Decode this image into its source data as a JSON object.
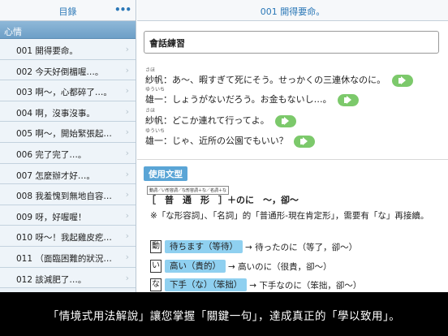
{
  "sidebar": {
    "title": "目錄",
    "section": "心情",
    "items": [
      {
        "label": "001 開得要命。"
      },
      {
        "label": "002 今天好倒楣喔…。"
      },
      {
        "label": "003 啊～，心都碎了…。"
      },
      {
        "label": "004 啊，沒事沒事。"
      },
      {
        "label": "005 啊～，開始緊張起…"
      },
      {
        "label": "006 完了完了…。"
      },
      {
        "label": "007 怎麼辦才好…。"
      },
      {
        "label": "008 我羞愧到無地自容…"
      },
      {
        "label": "009 呀，好喔喔！"
      },
      {
        "label": "010 呀～！我起雞皮疙…"
      },
      {
        "label": "011 （面臨困難的狀況…"
      },
      {
        "label": "012 該減肥了…。"
      }
    ]
  },
  "main": {
    "title": "001 開得要命。",
    "section_label": "會話練習",
    "dialog": [
      {
        "ruby": "さほ",
        "speaker": "紗帆",
        "line": "：あ～、暇すぎて死にそう。せっかくの三連休なのに。"
      },
      {
        "ruby": "ゆういち",
        "speaker": "雄一",
        "line": "：しょうがないだろう。お金もないし…。"
      },
      {
        "ruby": "さほ",
        "speaker": "紗帆",
        "line": "：どこか連れて行ってよ。"
      },
      {
        "ruby": "ゆういち",
        "speaker": "雄一",
        "line": "：じゃ、近所の公園でもいい？"
      }
    ],
    "usage_label": "使用文型",
    "mini_tabs": "動詞／い形容詞／な形容詞＋な／名詞＋な",
    "formula": "［　普　通　形　］＋のに　～，卻～",
    "note": "※「な形容詞」、「名詞」的「普通形-現在肯定形」，需要有「な」再接續。",
    "conjugations": [
      {
        "box": "動",
        "pill": "待ちます（等待）",
        "result": "→ 待ったのに（等了，卻～）"
      },
      {
        "box": "い",
        "pill": "高い（貴的）",
        "result": "→ 高いのに（很貴，卻～）"
      },
      {
        "box": "な",
        "pill": "下手（な）（笨拙）",
        "result": "→ 下手なのに（笨拙，卻～）"
      }
    ]
  },
  "caption": "「情境式用法解說」讓您掌握「關鍵一句」，達成真正的「學以致用」。",
  "colors": {
    "accent": "#2b78b7",
    "section": "#6d9fc7",
    "pill": "#8fd0f0",
    "play": "#7cc96b"
  }
}
